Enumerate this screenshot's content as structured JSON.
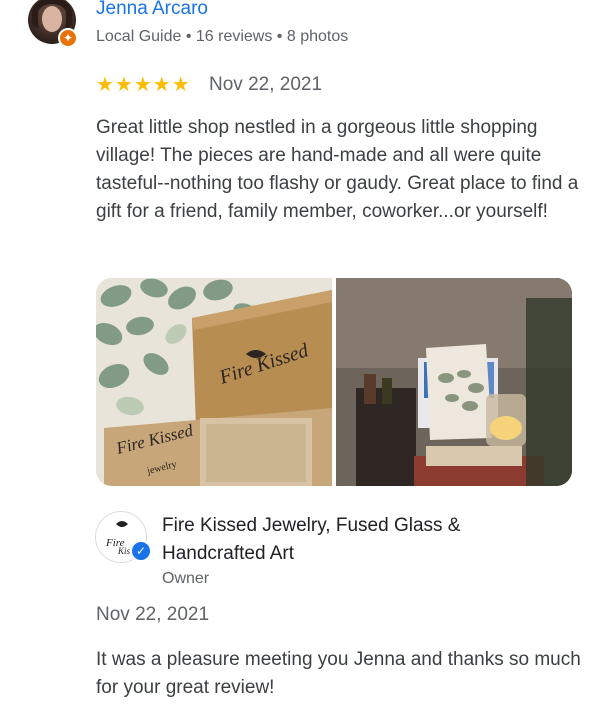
{
  "review": {
    "reviewer_name": "Jenna Arcaro",
    "reviewer_meta": "Local Guide • 16 reviews • 8 photos",
    "rating": 5,
    "stars_display": "★★★★★",
    "date": "Nov 22, 2021",
    "text": "Great little shop nestled in a gorgeous little shopping village! The pieces are hand-made and all were quite tasteful--nothing too flashy or gaudy. Great place to find a gift for a friend, family member, coworker...or yourself!"
  },
  "owner_reply": {
    "owner_name": "Fire Kissed Jewelry, Fused Glass & Handcrafted Art",
    "role": "Owner",
    "date": "Nov 22, 2021",
    "text": "It was a pleasure meeting you Jenna and thanks so much for your great review!"
  },
  "photos": [
    {
      "logo_text": "Fire Kissed",
      "sub_text": "jewelry"
    },
    {
      "logo_text": "",
      "sub_text": ""
    }
  ],
  "icons": {
    "local_guide_badge": "star-badge-icon",
    "verified_badge": "checkmark-badge-icon"
  },
  "colors": {
    "name_link": "#1a73e8",
    "star": "#fbbc04",
    "local_guide": "#e8710a",
    "verified": "#1a73e8"
  }
}
